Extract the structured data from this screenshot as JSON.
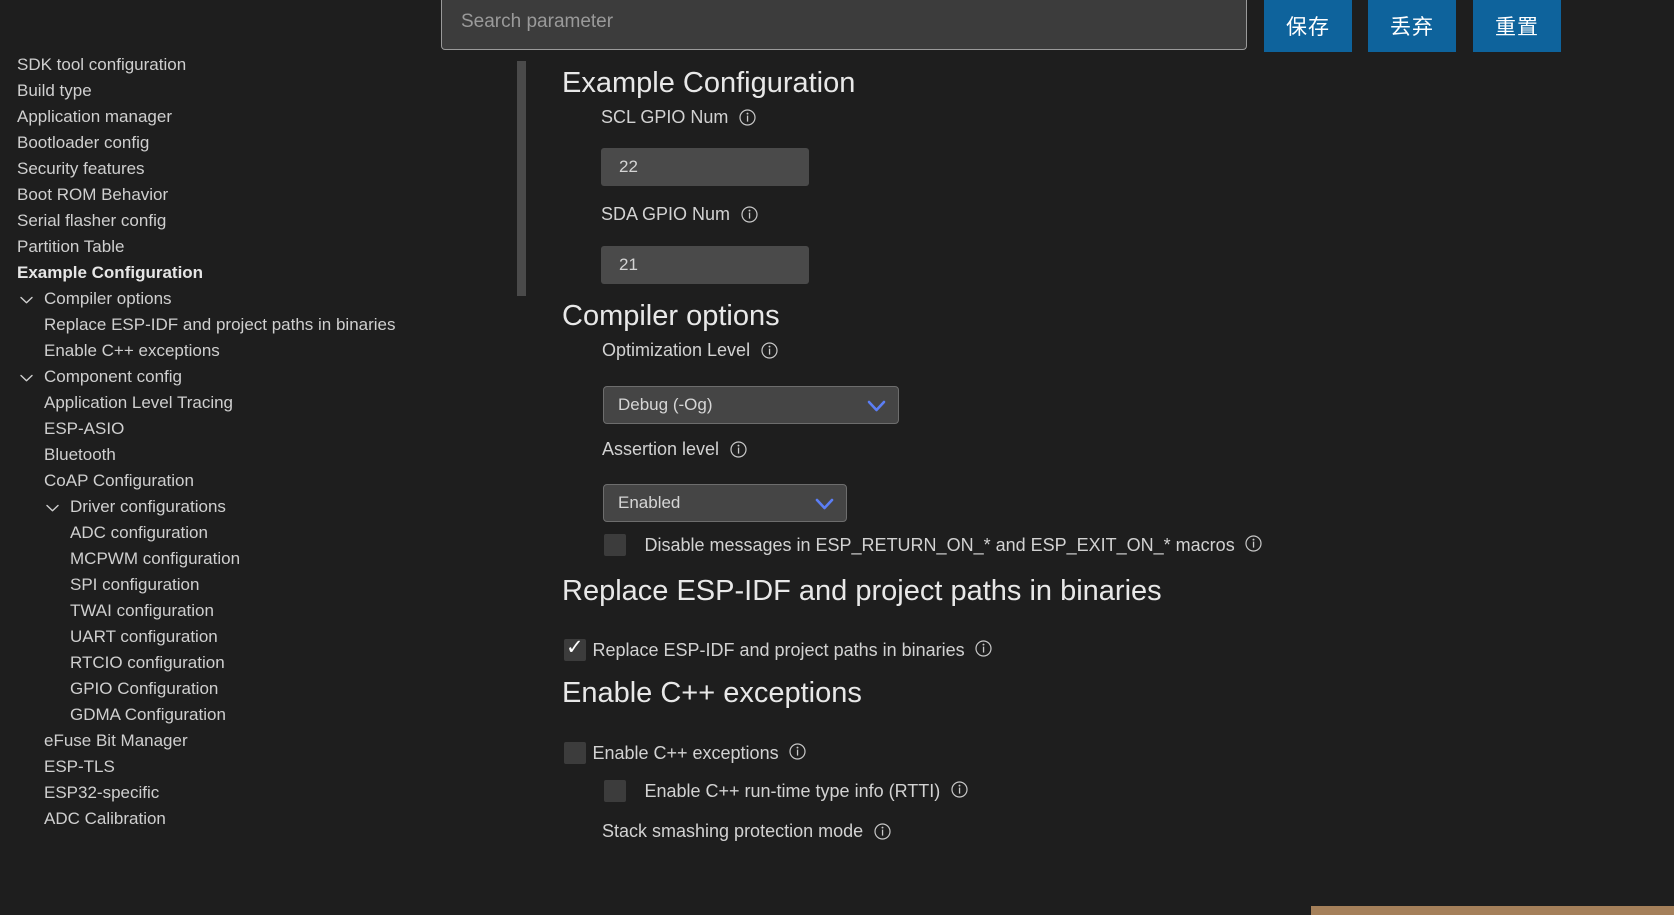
{
  "topbar": {
    "search": {
      "placeholder": "Search parameter",
      "value": ""
    },
    "buttons": [
      {
        "name": "save",
        "label": "保存"
      },
      {
        "name": "discard",
        "label": "丢弃"
      },
      {
        "name": "reset",
        "label": "重置"
      }
    ]
  },
  "sidebar": {
    "items": [
      {
        "label": "SDK tool configuration",
        "indent": 0,
        "chevron": false,
        "selected": false
      },
      {
        "label": "Build type",
        "indent": 0,
        "chevron": false,
        "selected": false
      },
      {
        "label": "Application manager",
        "indent": 0,
        "chevron": false,
        "selected": false
      },
      {
        "label": "Bootloader config",
        "indent": 0,
        "chevron": false,
        "selected": false
      },
      {
        "label": "Security features",
        "indent": 0,
        "chevron": false,
        "selected": false
      },
      {
        "label": "Boot ROM Behavior",
        "indent": 0,
        "chevron": false,
        "selected": false
      },
      {
        "label": "Serial flasher config",
        "indent": 0,
        "chevron": false,
        "selected": false
      },
      {
        "label": "Partition Table",
        "indent": 0,
        "chevron": false,
        "selected": false
      },
      {
        "label": "Example Configuration",
        "indent": 0,
        "chevron": false,
        "selected": true
      },
      {
        "label": "Compiler options",
        "indent": 1,
        "chevron": true,
        "selected": false
      },
      {
        "label": "Replace ESP-IDF and project paths in binaries",
        "indent": 1,
        "chevron": false,
        "selected": false
      },
      {
        "label": "Enable C++ exceptions",
        "indent": 1,
        "chevron": false,
        "selected": false
      },
      {
        "label": "Component config",
        "indent": 1,
        "chevron": true,
        "selected": false
      },
      {
        "label": "Application Level Tracing",
        "indent": 1,
        "chevron": false,
        "selected": false
      },
      {
        "label": "ESP-ASIO",
        "indent": 1,
        "chevron": false,
        "selected": false
      },
      {
        "label": "Bluetooth",
        "indent": 1,
        "chevron": false,
        "selected": false
      },
      {
        "label": "CoAP Configuration",
        "indent": 1,
        "chevron": false,
        "selected": false
      },
      {
        "label": "Driver configurations",
        "indent": 2,
        "chevron": true,
        "selected": false
      },
      {
        "label": "ADC configuration",
        "indent": 2,
        "chevron": false,
        "selected": false
      },
      {
        "label": "MCPWM configuration",
        "indent": 2,
        "chevron": false,
        "selected": false
      },
      {
        "label": "SPI configuration",
        "indent": 2,
        "chevron": false,
        "selected": false
      },
      {
        "label": "TWAI configuration",
        "indent": 2,
        "chevron": false,
        "selected": false
      },
      {
        "label": "UART configuration",
        "indent": 2,
        "chevron": false,
        "selected": false
      },
      {
        "label": "RTCIO configuration",
        "indent": 2,
        "chevron": false,
        "selected": false
      },
      {
        "label": "GPIO Configuration",
        "indent": 2,
        "chevron": false,
        "selected": false
      },
      {
        "label": "GDMA Configuration",
        "indent": 2,
        "chevron": false,
        "selected": false
      },
      {
        "label": "eFuse Bit Manager",
        "indent": 1,
        "chevron": false,
        "selected": false
      },
      {
        "label": "ESP-TLS",
        "indent": 1,
        "chevron": false,
        "selected": false
      },
      {
        "label": "ESP32-specific",
        "indent": 1,
        "chevron": false,
        "selected": false
      },
      {
        "label": "ADC Calibration",
        "indent": 1,
        "chevron": false,
        "selected": false
      }
    ]
  },
  "main": {
    "example_configuration": {
      "heading": "Example Configuration",
      "scl_label": "SCL GPIO Num",
      "scl_value": "22",
      "sda_label": "SDA GPIO Num",
      "sda_value": "21"
    },
    "compiler_options": {
      "heading": "Compiler options",
      "optimization_label": "Optimization Level",
      "optimization_value": "Debug (-Og)",
      "assertion_label": "Assertion level",
      "assertion_value": "Enabled",
      "disable_messages_label": "Disable messages in ESP_RETURN_ON_* and ESP_EXIT_ON_* macros",
      "disable_messages_checked": false
    },
    "replace_paths": {
      "heading": "Replace ESP-IDF and project paths in binaries",
      "checkbox_label": "Replace ESP-IDF and project paths in binaries",
      "checked": true
    },
    "cpp_exceptions": {
      "heading": "Enable C++ exceptions",
      "enable_label": "Enable C++ exceptions",
      "enable_checked": false,
      "rtti_label": "Enable C++ run-time type info (RTTI)",
      "rtti_checked": false,
      "stack_smash_label": "Stack smashing protection mode"
    }
  },
  "colors": {
    "accent_blue": "#0e639c",
    "background": "#1e1e1e",
    "input_bg": "#4a4a4a",
    "bottom_bar": "#a5805a"
  }
}
